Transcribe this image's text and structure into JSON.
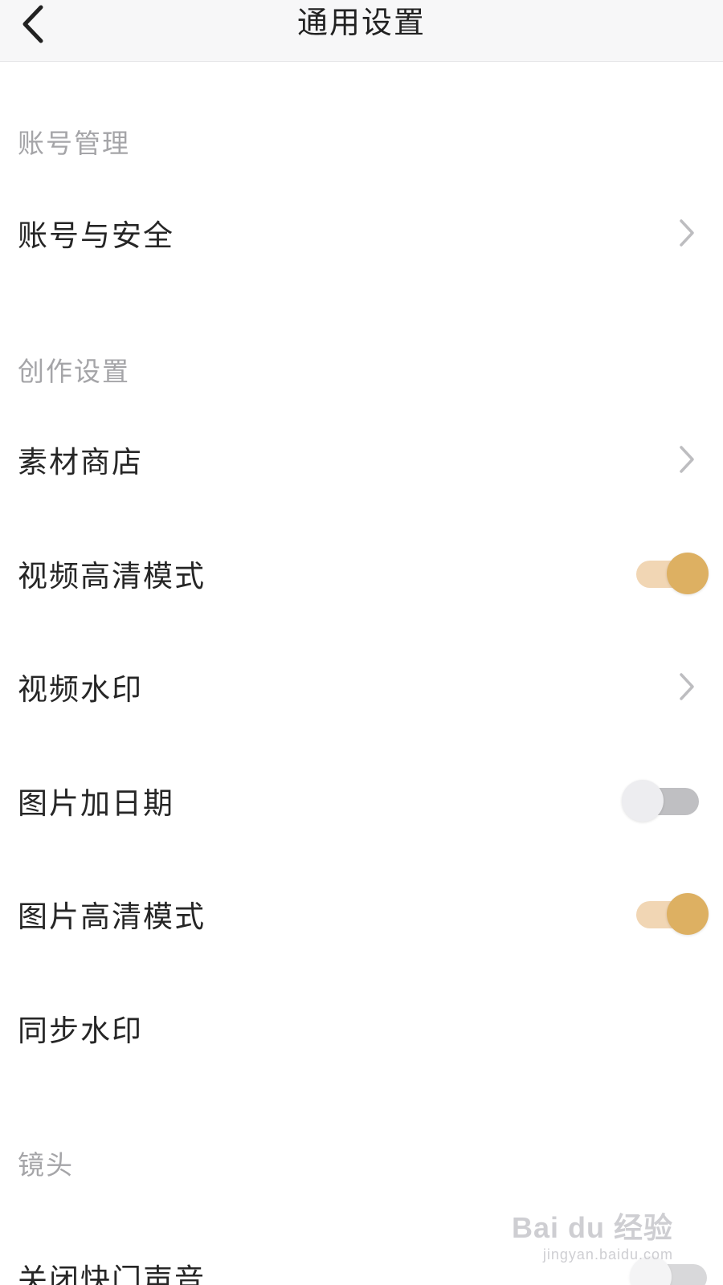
{
  "header": {
    "title": "通用设置",
    "back_icon": "chevron-left-icon"
  },
  "sections": {
    "account": {
      "title": "账号管理"
    },
    "creation": {
      "title": "创作设置"
    },
    "lens": {
      "title": "镜头"
    }
  },
  "items": {
    "account_security": {
      "label": "账号与安全",
      "type": "link"
    },
    "material_store": {
      "label": "素材商店",
      "type": "link"
    },
    "video_hd": {
      "label": "视频高清模式",
      "type": "toggle",
      "on": true
    },
    "video_watermark": {
      "label": "视频水印",
      "type": "link"
    },
    "photo_date": {
      "label": "图片加日期",
      "type": "toggle",
      "on": false
    },
    "photo_hd": {
      "label": "图片高清模式",
      "type": "toggle",
      "on": true
    },
    "sync_watermark": {
      "label": "同步水印",
      "type": "none"
    },
    "shutter_sound": {
      "label": "关闭快门声音",
      "type": "toggle",
      "on": false
    }
  },
  "colors": {
    "accent": "#ddb062",
    "accent_track": "#f1d6b4",
    "off_track": "#bfbfc2",
    "off_knob": "#ededf0",
    "section_text": "#a5a5a8",
    "chevron": "#bdbdc0"
  },
  "watermark": {
    "brand": "Bai du 经验",
    "site": "jingyan.baidu.com"
  }
}
